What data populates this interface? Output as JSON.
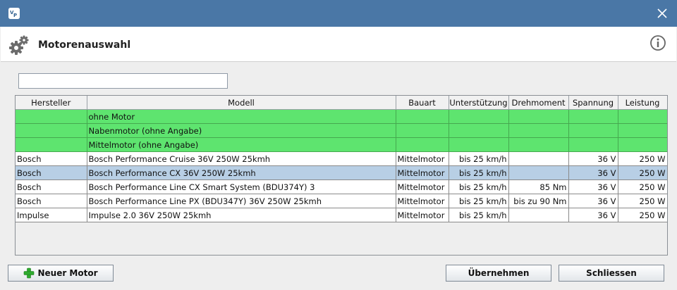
{
  "window": {
    "app_icon": "vp-app-icon",
    "close_icon": "close-icon"
  },
  "header": {
    "title": "Motorenauswahl",
    "icon": "gear-icon",
    "info_icon": "info-icon"
  },
  "search": {
    "value": "",
    "placeholder": ""
  },
  "table": {
    "columns": [
      "Hersteller",
      "Modell",
      "Bauart",
      "Unterstützung",
      "Drehmoment",
      "Spannung",
      "Leistung"
    ],
    "rows": [
      {
        "hersteller": "",
        "modell": "ohne Motor",
        "bauart": "",
        "unterstuetzung": "",
        "drehmoment": "",
        "spannung": "",
        "leistung": "",
        "style": "green"
      },
      {
        "hersteller": "",
        "modell": "Nabenmotor (ohne Angabe)",
        "bauart": "",
        "unterstuetzung": "",
        "drehmoment": "",
        "spannung": "",
        "leistung": "",
        "style": "green"
      },
      {
        "hersteller": "",
        "modell": "Mittelmotor (ohne Angabe)",
        "bauart": "",
        "unterstuetzung": "",
        "drehmoment": "",
        "spannung": "",
        "leistung": "",
        "style": "green"
      },
      {
        "hersteller": "Bosch",
        "modell": "Bosch Performance Cruise 36V 250W 25kmh",
        "bauart": "Mittelmotor",
        "unterstuetzung": "bis 25 km/h",
        "drehmoment": "",
        "spannung": "36 V",
        "leistung": "250 W",
        "style": "normal"
      },
      {
        "hersteller": "Bosch",
        "modell": "Bosch Performance CX 36V 250W 25kmh",
        "bauart": "Mittelmotor",
        "unterstuetzung": "bis 25 km/h",
        "drehmoment": "",
        "spannung": "36 V",
        "leistung": "250 W",
        "style": "selected"
      },
      {
        "hersteller": "Bosch",
        "modell": "Bosch Performance Line CX Smart System (BDU374Y) 3",
        "bauart": "Mittelmotor",
        "unterstuetzung": "bis 25 km/h",
        "drehmoment": "85 Nm",
        "spannung": "36 V",
        "leistung": "250 W",
        "style": "normal"
      },
      {
        "hersteller": "Bosch",
        "modell": "Bosch Performance Line PX (BDU347Y) 36V 250W 25kmh",
        "bauart": "Mittelmotor",
        "unterstuetzung": "bis 25 km/h",
        "drehmoment": "bis zu 90 Nm",
        "spannung": "36 V",
        "leistung": "250 W",
        "style": "normal"
      },
      {
        "hersteller": "Impulse",
        "modell": "Impulse 2.0 36V 250W 25kmh",
        "bauart": "Mittelmotor",
        "unterstuetzung": "bis 25 km/h",
        "drehmoment": "",
        "spannung": "36 V",
        "leistung": "250 W",
        "style": "normal"
      }
    ]
  },
  "buttons": {
    "new_motor": "Neuer Motor",
    "apply": "Übernehmen",
    "close": "Schliessen"
  },
  "colors": {
    "titlebar": "#4a77a6",
    "green_row": "#5ee46f",
    "selected_row": "#b8cfe5"
  }
}
